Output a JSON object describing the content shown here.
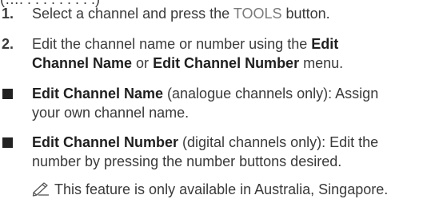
{
  "top_fragment": "(…. . . . . . . . . .)",
  "steps": [
    {
      "number": "1.",
      "pre": "Select a channel and press the ",
      "button_word": "TOOLS",
      "post": " button."
    },
    {
      "number": "2.",
      "line1_pre": "Edit the channel name or number using the ",
      "line1_bold": "Edit",
      "line2_bold_a": "Channel Name",
      "line2_mid": " or ",
      "line2_bold_b": "Edit Channel Number",
      "line2_post": " menu."
    }
  ],
  "bullets": [
    {
      "bold": "Edit Channel Name",
      "line1_rest": " (analogue channels only): Assign",
      "line2": "your own channel name."
    },
    {
      "bold": "Edit Channel Number",
      "line1_rest": " (digital channels only): Edit the",
      "line2": "number by pressing the number buttons desired."
    }
  ],
  "note": {
    "icon": "pencil-note-icon",
    "text": "This feature is only available in Australia, Singapore."
  }
}
